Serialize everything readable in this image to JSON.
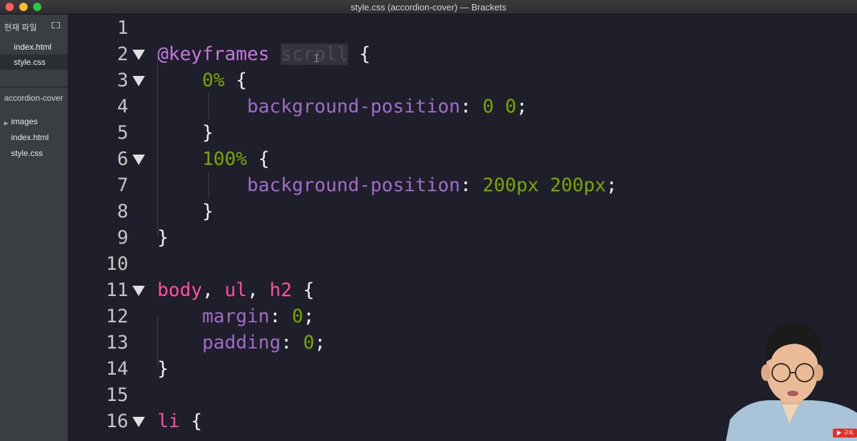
{
  "window": {
    "title": "style.css (accordion-cover) — Brackets"
  },
  "sidebar": {
    "working_files_header": "현재 파일",
    "working_files": [
      {
        "name": "index.html",
        "selected": false
      },
      {
        "name": "style.css",
        "selected": true
      }
    ],
    "project_name": "accordion-cover",
    "tree": [
      {
        "name": "images",
        "type": "folder"
      },
      {
        "name": "index.html",
        "type": "file"
      },
      {
        "name": "style.css",
        "type": "file"
      }
    ]
  },
  "editor": {
    "lines": [
      {
        "n": "1",
        "tokens": []
      },
      {
        "n": "2",
        "fold": true,
        "tokens": [
          {
            "t": "@keyframes",
            "c": "kw"
          },
          {
            "t": " "
          },
          {
            "t": "scroll",
            "c": "hl"
          },
          {
            "t": " {",
            "c": "punct"
          }
        ]
      },
      {
        "n": "3",
        "fold": true,
        "tokens": [
          {
            "t": "    "
          },
          {
            "t": "0%",
            "c": "num"
          },
          {
            "t": " {",
            "c": "punct"
          }
        ]
      },
      {
        "n": "4",
        "tokens": [
          {
            "t": "        "
          },
          {
            "t": "background-position",
            "c": "prop"
          },
          {
            "t": ": ",
            "c": "punct"
          },
          {
            "t": "0",
            "c": "num"
          },
          {
            "t": " "
          },
          {
            "t": "0",
            "c": "num"
          },
          {
            "t": ";",
            "c": "punct"
          }
        ]
      },
      {
        "n": "5",
        "tokens": [
          {
            "t": "    "
          },
          {
            "t": "}",
            "c": "punct"
          }
        ]
      },
      {
        "n": "6",
        "fold": true,
        "tokens": [
          {
            "t": "    "
          },
          {
            "t": "100%",
            "c": "num"
          },
          {
            "t": " {",
            "c": "punct"
          }
        ]
      },
      {
        "n": "7",
        "tokens": [
          {
            "t": "        "
          },
          {
            "t": "background-position",
            "c": "prop"
          },
          {
            "t": ": ",
            "c": "punct"
          },
          {
            "t": "200px",
            "c": "num"
          },
          {
            "t": " "
          },
          {
            "t": "200px",
            "c": "num"
          },
          {
            "t": ";",
            "c": "punct"
          }
        ]
      },
      {
        "n": "8",
        "tokens": [
          {
            "t": "    "
          },
          {
            "t": "}",
            "c": "punct"
          }
        ]
      },
      {
        "n": "9",
        "tokens": [
          {
            "t": "}",
            "c": "punct"
          }
        ]
      },
      {
        "n": "10",
        "tokens": []
      },
      {
        "n": "11",
        "fold": true,
        "tokens": [
          {
            "t": "body",
            "c": "sel-tag"
          },
          {
            "t": ", ",
            "c": "punct"
          },
          {
            "t": "ul",
            "c": "sel-tag"
          },
          {
            "t": ", ",
            "c": "punct"
          },
          {
            "t": "h2",
            "c": "sel-tag"
          },
          {
            "t": " {",
            "c": "punct"
          }
        ]
      },
      {
        "n": "12",
        "tokens": [
          {
            "t": "    "
          },
          {
            "t": "margin",
            "c": "prop"
          },
          {
            "t": ": ",
            "c": "punct"
          },
          {
            "t": "0",
            "c": "num"
          },
          {
            "t": ";",
            "c": "punct"
          }
        ]
      },
      {
        "n": "13",
        "tokens": [
          {
            "t": "    "
          },
          {
            "t": "padding",
            "c": "prop"
          },
          {
            "t": ": ",
            "c": "punct"
          },
          {
            "t": "0",
            "c": "num"
          },
          {
            "t": ";",
            "c": "punct"
          }
        ]
      },
      {
        "n": "14",
        "tokens": [
          {
            "t": "}",
            "c": "punct"
          }
        ]
      },
      {
        "n": "15",
        "tokens": []
      },
      {
        "n": "16",
        "fold": true,
        "tokens": [
          {
            "t": "li",
            "c": "sel-tag"
          },
          {
            "t": " {",
            "c": "punct"
          }
        ]
      }
    ]
  },
  "colors": {
    "editor_bg": "#1f1f2b",
    "keyword": "#c678dd",
    "property": "#a06cc8",
    "number": "#78a800",
    "selector_tag": "#ff4fa2"
  }
}
